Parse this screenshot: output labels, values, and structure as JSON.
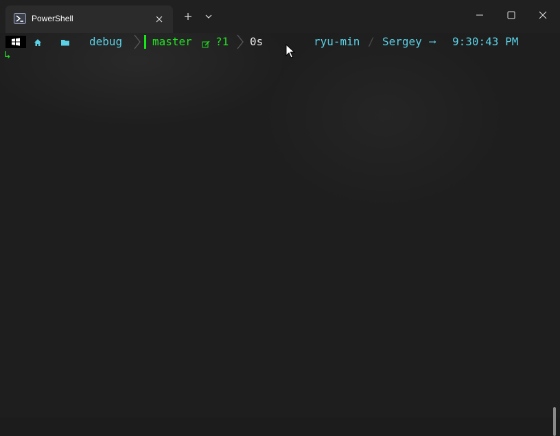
{
  "window": {
    "tab_title": "PowerShell",
    "tab_icon": "powershell-icon",
    "close_tab_icon": "close-icon",
    "new_tab_icon": "plus-icon",
    "dropdown_icon": "chevron-down-icon",
    "controls": [
      "minimize-icon",
      "maximize-icon",
      "close-icon"
    ]
  },
  "prompt": {
    "os_icon": "windows-icon",
    "home_icon": "home-icon",
    "folder_icon": "folder-icon",
    "path": "debug",
    "branch_icon": "git-branch-icon",
    "branch": "master",
    "changes_icon": "edit-icon",
    "untracked": "?1",
    "duration": "0s",
    "host": "ryu-min",
    "separator": "/",
    "user": "Sergey",
    "arrow": "⟶",
    "time": "9:30:43 PM",
    "second_line_symbol": "↳"
  },
  "colors": {
    "terminal_bg": "#1e1e1e",
    "titlebar_bg": "#202020",
    "tab_bg": "#2b2b2b",
    "cyan": "#5ad1e6",
    "green": "#22e022",
    "white": "#e6e6e6"
  }
}
